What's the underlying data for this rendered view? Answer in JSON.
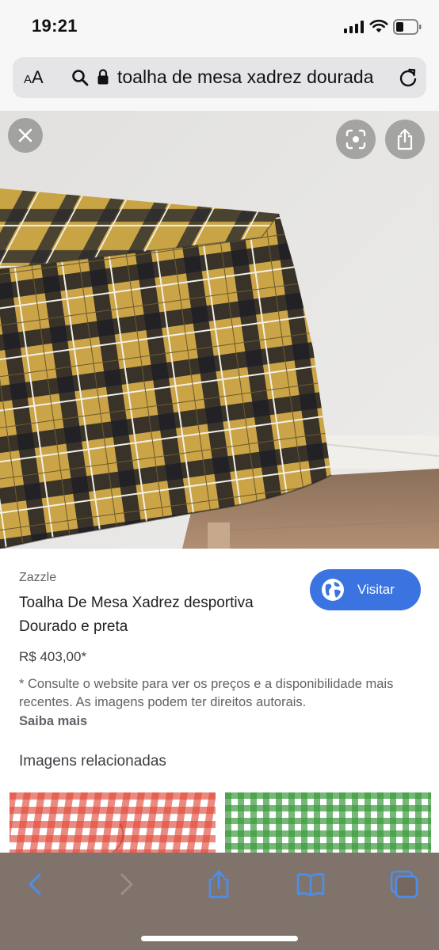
{
  "status_bar": {
    "time": "19:21"
  },
  "browser": {
    "text_size_label_small": "A",
    "text_size_label_large": "A",
    "url": "toalha de mesa xadrez dourada"
  },
  "result": {
    "source": "Zazzle",
    "title": "Toalha De Mesa Xadrez desportiva Dourado e preta",
    "visit_label": "Visitar",
    "price": "R$ 403,00*",
    "disclaimer": "* Consulte o website para ver os preços e a disponibilidade mais recentes. As imagens podem ter direitos autorais.",
    "learn_more": "Saiba mais",
    "related_heading": "Imagens relacionadas"
  },
  "colors": {
    "accent_blue": "#3b74e0",
    "plaid_gold": "#c9a445",
    "plaid_black": "#1e1f24",
    "toolbar_tint": "#766860",
    "toolbar_icon_active": "#4a8ff0"
  },
  "icons": {
    "close": "close-icon",
    "lens": "visual-search-icon",
    "share_overlay": "share-icon",
    "visit": "globe-icon",
    "back": "chevron-left-icon",
    "forward": "chevron-right-icon",
    "share": "share-icon",
    "bookmarks": "book-icon",
    "tabs": "tabs-icon"
  }
}
